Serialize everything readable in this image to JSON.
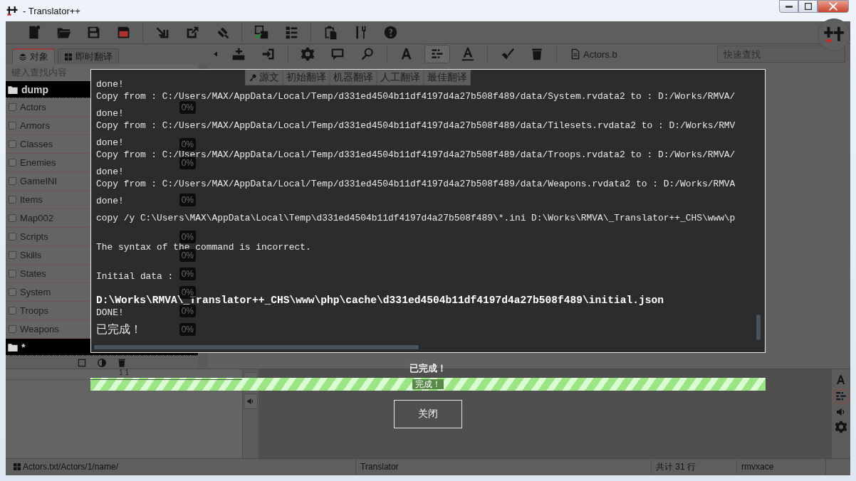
{
  "window": {
    "title": "- Translator++"
  },
  "sidebar": {
    "tabs": [
      {
        "label": "对象",
        "selected": true
      },
      {
        "label": "即时翻译",
        "selected": false
      }
    ],
    "search": {
      "placeholder": "键入查找内容"
    },
    "folders": [
      {
        "name": "dump",
        "children": [
          {
            "name": "Actors",
            "checked": false,
            "progress": "0%"
          },
          {
            "name": "Armors",
            "checked": false
          },
          {
            "name": "Classes",
            "checked": false,
            "progress": "0%"
          },
          {
            "name": "Enemies",
            "checked": false,
            "progress": "0%"
          },
          {
            "name": "GameINI",
            "checked": false
          },
          {
            "name": "Items",
            "checked": false,
            "progress": "0%"
          },
          {
            "name": "Map002",
            "checked": false
          },
          {
            "name": "Scripts",
            "checked": false,
            "progress": "0%"
          },
          {
            "name": "Skills",
            "checked": false,
            "progress": "0%"
          },
          {
            "name": "States",
            "checked": false,
            "progress": "0%"
          },
          {
            "name": "System",
            "checked": false,
            "progress": "0%"
          },
          {
            "name": "Troops",
            "checked": false,
            "progress": "0%"
          },
          {
            "name": "Weapons",
            "checked": false,
            "progress": "0%"
          }
        ]
      },
      {
        "name": "*"
      }
    ]
  },
  "file_tab": {
    "label": "Actors.b"
  },
  "quick_search": {
    "placeholder": "快速查找"
  },
  "grid": {
    "columns": [
      "源文",
      "初始翻译",
      "机器翻译",
      "人工翻译",
      "最佳翻译"
    ]
  },
  "lower_panel": {
    "header": "1 1"
  },
  "dialog": {
    "lines": [
      {
        "kind": "first",
        "text": "done!"
      },
      {
        "kind": "cont",
        "text": "Copy from : C:/Users/MAX/AppData/Local/Temp/d331ed4504b11df4197d4a27b508f489/data/System.rvdata2 to : D:/Works/RMVA/"
      },
      {
        "kind": "line",
        "text": "done!"
      },
      {
        "kind": "cont",
        "text": "Copy from : C:/Users/MAX/AppData/Local/Temp/d331ed4504b11df4197d4a27b508f489/data/Tilesets.rvdata2 to : D:/Works/RMV"
      },
      {
        "kind": "line",
        "text": "done!"
      },
      {
        "kind": "cont",
        "text": "Copy from : C:/Users/MAX/AppData/Local/Temp/d331ed4504b11df4197d4a27b508f489/data/Troops.rvdata2 to : D:/Works/RMVA/"
      },
      {
        "kind": "line",
        "text": "done!"
      },
      {
        "kind": "cont",
        "text": "Copy from : C:/Users/MAX/AppData/Local/Temp/d331ed4504b11df4197d4a27b508f489/data/Weapons.rvdata2 to : D:/Works/RMVA"
      },
      {
        "kind": "line",
        "text": "done!"
      },
      {
        "kind": "line",
        "text": "copy /y C:\\Users\\MAX\\AppData\\Local\\Temp\\d331ed4504b11df4197d4a27b508f489\\*.ini D:\\Works\\RMVA\\_Translator++_CHS\\www\\p"
      },
      {
        "kind": "para",
        "text": "The syntax of the command is incorrect."
      },
      {
        "kind": "para",
        "text": "Initial data :"
      },
      {
        "kind": "bold",
        "text": "D:\\Works\\RMVA\\_Translator++_CHS\\www\\php\\cache\\d331ed4504b11df4197d4a27b508f489\\initial.json"
      },
      {
        "kind": "cont",
        "text": "DONE!"
      },
      {
        "kind": "large",
        "text": "已完成！"
      }
    ],
    "status": "已完成！",
    "progress": {
      "level": 1,
      "label": "完成！"
    },
    "buttons": [
      "关闭"
    ]
  },
  "status_bar": {
    "path": "Actors.txt/Actors/1/name/",
    "engine": "Translator",
    "count": "共计 31 行",
    "game_type": "rmvxace"
  }
}
